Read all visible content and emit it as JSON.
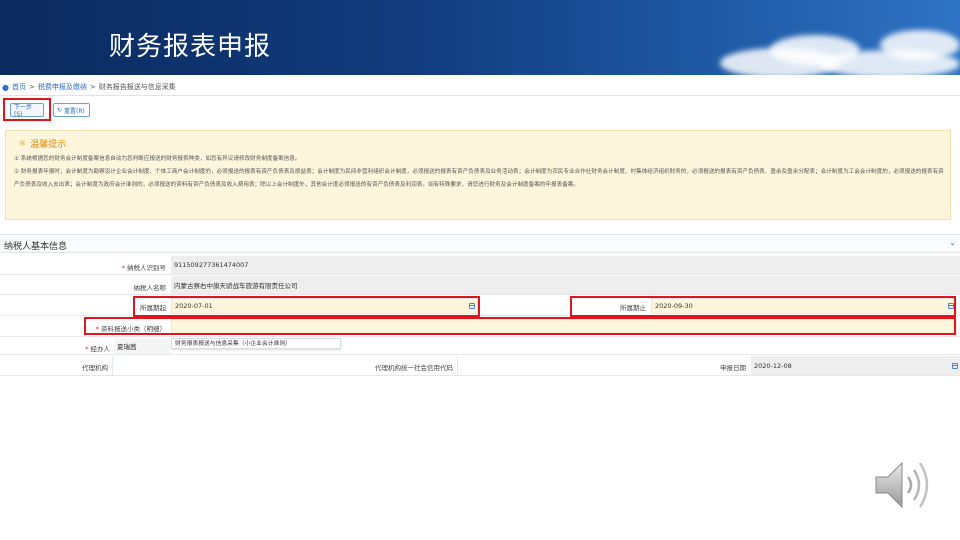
{
  "slide": {
    "title": "财务报表申报"
  },
  "breadcrumb": {
    "home": "首页",
    "sep": ">",
    "level1": "税费申报及缴纳",
    "level2": "财务报告报送与信息采集"
  },
  "toolbar": {
    "next_label": "下一步(S)",
    "reset_label": "重置(R)"
  },
  "tips": {
    "title": "温馨提示",
    "line1": "① 系统根据您的财务会计制度备案信息自动为您判断应报送的财务报表种类，如您有异议请修改财务制度备案信息。",
    "line2": "② 财务报表年报时，会计制度为勘察设计企业会计制度、个体工商户会计制度的，必须报送的报表有资产负债表及损益表；会计制度为民间非营利组织会计制度，必须报送的报表有资产负债表及业务活动表；会计制度为农民专业合作社财务会计制度、村集体经济组织财务的，必须报送的报表有资产负债表、盈余及盈余分配表；会计制度为工会会计制度的，必须报送的报表有资产负债表及收入支出表；会计制度为政府会计准则的，必须报送的资料有资产负债表及收入费用表；除以上会计制度外，其他会计度必须报送的有资产负债表及利润表。如有特殊要求，请您进行财务及会计制度备案的年报表备案。"
  },
  "section": {
    "title": "纳税人基本信息"
  },
  "form": {
    "taxpayer_id_label": "纳税人识别号",
    "taxpayer_id": "911509277361474007",
    "taxpayer_name_label": "纳税人名称",
    "taxpayer_name": "内蒙古察右中旗天骄战车旅游有限责任公司",
    "period_start_label": "所属期起",
    "period_start": "2020-07-01",
    "period_end_label": "所属期止",
    "period_end": "2020-09-30",
    "category_label": "资料报送小类（明细）",
    "category_value": "",
    "operator_label": "经办人",
    "operator": "夏瑞茜",
    "category_option": "财务报表报送与信息采集（小企业会计准则）",
    "agency_label": "代理机构",
    "agency": "",
    "agency_code_label": "代理机构统一社会信用代码",
    "agency_code": "",
    "report_date_label": "申报日期",
    "report_date": "2020-12-08"
  },
  "colors": {
    "banner": "#123d80",
    "highlight": "#e0141c",
    "accent": "#2a6fc9",
    "tips_bg": "#fdf6dc"
  }
}
